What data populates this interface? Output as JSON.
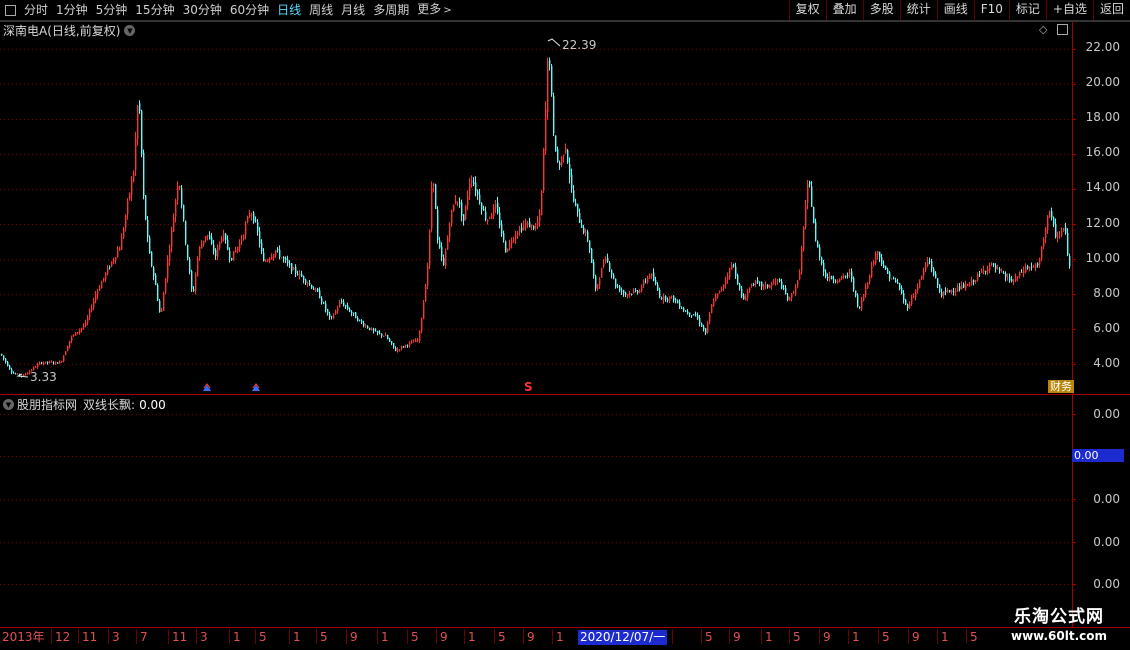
{
  "toolbar": {
    "periods": [
      "分时",
      "1分钟",
      "5分钟",
      "15分钟",
      "30分钟",
      "60分钟",
      "日线",
      "周线",
      "月线",
      "多周期"
    ],
    "active_period": "日线",
    "more_label": "更多",
    "right_buttons": [
      "复权",
      "叠加",
      "多股",
      "统计",
      "画线",
      "F10",
      "标记",
      "+自选",
      "返回"
    ]
  },
  "main_pane": {
    "title": "深南电A(日线,前复权)",
    "high_label": "22.39",
    "low_label": "3.33",
    "price_axis": [
      "22.00",
      "20.00",
      "18.00",
      "16.00",
      "14.00",
      "12.00",
      "10.00",
      "8.00",
      "6.00",
      "4.00"
    ],
    "event_marker_s": "S",
    "badge_text": "财务"
  },
  "indicator_pane": {
    "title_prefix": "股朋指标网",
    "indicator_name": "双线长飘:",
    "indicator_value": "0.00",
    "axis": [
      "0.00",
      "0.00",
      "0.00",
      "0.00",
      "0.00"
    ],
    "current_value": "0.00"
  },
  "date_axis": {
    "labels": [
      "2013年",
      "12",
      "11",
      "3",
      "7",
      "11",
      "3",
      "1",
      "5",
      "1",
      "5",
      "9",
      "1",
      "5",
      "9",
      "1",
      "5",
      "9",
      "1",
      "5",
      "9",
      "1",
      "5",
      "9",
      "1",
      "5",
      "9",
      "1",
      "5"
    ],
    "cursor_label": "2020/12/07/一"
  },
  "watermark": {
    "main": "乐淘公式网",
    "url": "www.60lt.com"
  },
  "colors": {
    "up": "#ff3232",
    "down": "#54ffff",
    "grid": "#7a0000",
    "axis_border": "#a00000",
    "highlight": "#1b2bd0"
  },
  "chart_data": {
    "type": "candlestick",
    "ylim": [
      3.0,
      23.0
    ],
    "y_ticks": [
      4,
      6,
      8,
      10,
      12,
      14,
      16,
      18,
      20,
      22
    ],
    "x_labels": [
      "2013年",
      "12",
      "11",
      "3",
      "7",
      "11",
      "3",
      "1",
      "5",
      "1",
      "5",
      "9",
      "1",
      "5",
      "9",
      "1",
      "5",
      "9",
      "1",
      "5",
      "9",
      "1",
      "5",
      "9",
      "1",
      "5",
      "9",
      "1",
      "5"
    ],
    "price_path": [
      [
        0,
        4.6
      ],
      [
        12,
        3.5
      ],
      [
        22,
        3.33
      ],
      [
        40,
        4.1
      ],
      [
        60,
        4.1
      ],
      [
        70,
        5.5
      ],
      [
        85,
        6.3
      ],
      [
        95,
        8.0
      ],
      [
        108,
        9.5
      ],
      [
        120,
        10.8
      ],
      [
        128,
        13.5
      ],
      [
        133,
        15.0
      ],
      [
        138,
        19.6
      ],
      [
        143,
        13.5
      ],
      [
        148,
        10.5
      ],
      [
        155,
        8.5
      ],
      [
        160,
        6.6
      ],
      [
        166,
        9.5
      ],
      [
        172,
        12.0
      ],
      [
        178,
        14.8
      ],
      [
        185,
        11.0
      ],
      [
        192,
        7.8
      ],
      [
        198,
        10.5
      ],
      [
        206,
        11.5
      ],
      [
        215,
        10.2
      ],
      [
        222,
        11.5
      ],
      [
        230,
        10.0
      ],
      [
        240,
        11.0
      ],
      [
        250,
        12.8
      ],
      [
        256,
        11.8
      ],
      [
        263,
        9.8
      ],
      [
        275,
        10.5
      ],
      [
        290,
        9.5
      ],
      [
        305,
        8.8
      ],
      [
        318,
        8.0
      ],
      [
        330,
        6.5
      ],
      [
        340,
        7.6
      ],
      [
        350,
        7.0
      ],
      [
        360,
        6.4
      ],
      [
        375,
        5.8
      ],
      [
        385,
        5.6
      ],
      [
        395,
        4.8
      ],
      [
        405,
        5.1
      ],
      [
        418,
        5.4
      ],
      [
        424,
        8.0
      ],
      [
        428,
        10.2
      ],
      [
        432,
        15.4
      ],
      [
        437,
        11.0
      ],
      [
        443,
        9.6
      ],
      [
        450,
        12.5
      ],
      [
        456,
        13.6
      ],
      [
        463,
        12.2
      ],
      [
        470,
        14.8
      ],
      [
        478,
        13.5
      ],
      [
        486,
        12.2
      ],
      [
        495,
        13.0
      ],
      [
        505,
        10.5
      ],
      [
        515,
        11.5
      ],
      [
        525,
        12.0
      ],
      [
        535,
        11.8
      ],
      [
        540,
        12.6
      ],
      [
        545,
        18.5
      ],
      [
        548,
        22.39
      ],
      [
        553,
        17.0
      ],
      [
        558,
        15.2
      ],
      [
        565,
        16.5
      ],
      [
        572,
        13.5
      ],
      [
        580,
        12.0
      ],
      [
        588,
        11.0
      ],
      [
        595,
        8.2
      ],
      [
        605,
        10.2
      ],
      [
        615,
        8.5
      ],
      [
        625,
        8.0
      ],
      [
        638,
        8.2
      ],
      [
        650,
        9.2
      ],
      [
        660,
        7.8
      ],
      [
        672,
        7.8
      ],
      [
        685,
        7.0
      ],
      [
        695,
        6.8
      ],
      [
        705,
        5.8
      ],
      [
        712,
        7.6
      ],
      [
        720,
        8.2
      ],
      [
        732,
        9.8
      ],
      [
        742,
        7.6
      ],
      [
        752,
        8.7
      ],
      [
        765,
        8.4
      ],
      [
        778,
        8.8
      ],
      [
        788,
        7.6
      ],
      [
        798,
        8.8
      ],
      [
        808,
        14.7
      ],
      [
        815,
        11.0
      ],
      [
        825,
        9.0
      ],
      [
        838,
        8.8
      ],
      [
        850,
        9.2
      ],
      [
        858,
        7.0
      ],
      [
        866,
        8.6
      ],
      [
        876,
        10.5
      ],
      [
        886,
        9.2
      ],
      [
        898,
        8.5
      ],
      [
        906,
        7.2
      ],
      [
        915,
        8.2
      ],
      [
        928,
        10.0
      ],
      [
        940,
        8.0
      ],
      [
        955,
        8.3
      ],
      [
        968,
        8.5
      ],
      [
        980,
        9.2
      ],
      [
        990,
        9.7
      ],
      [
        1000,
        9.2
      ],
      [
        1012,
        8.7
      ],
      [
        1025,
        9.5
      ],
      [
        1038,
        9.6
      ],
      [
        1048,
        12.8
      ],
      [
        1056,
        11.2
      ],
      [
        1064,
        11.8
      ],
      [
        1070,
        9.0
      ]
    ]
  }
}
